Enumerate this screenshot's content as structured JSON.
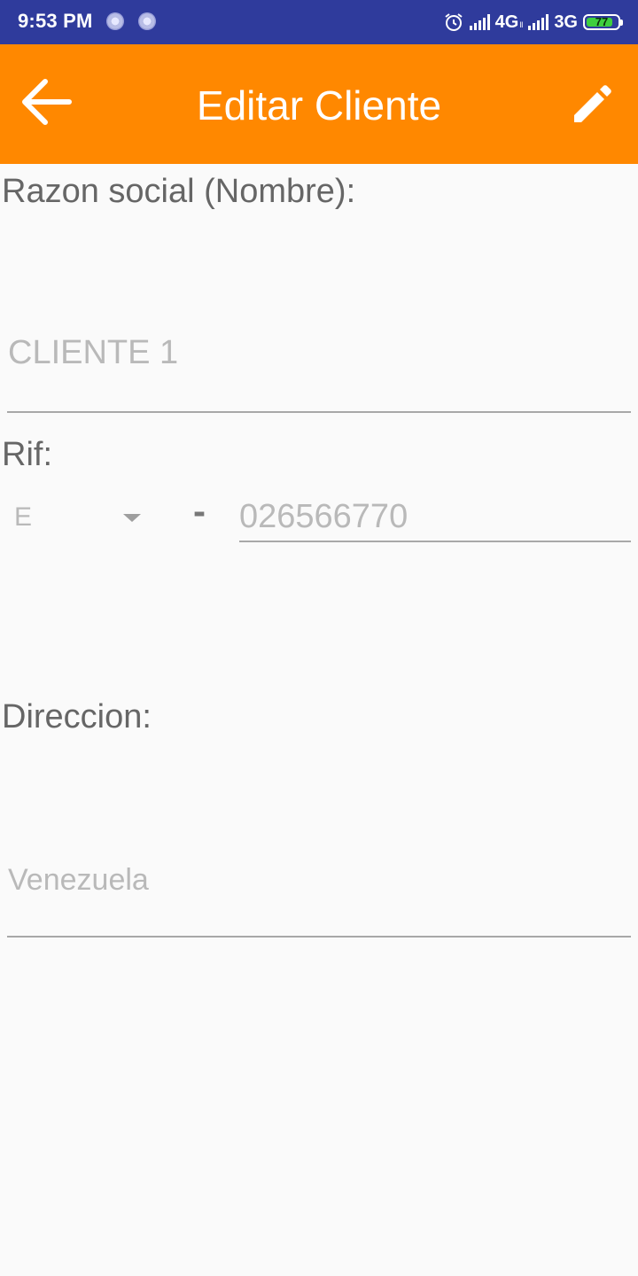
{
  "status_bar": {
    "time": "9:53 PM",
    "network1": "4G",
    "network1_sub": "ll",
    "network2": "3G",
    "battery": "77",
    "icons": [
      "notification-dot-icon",
      "notification-dot-icon",
      "alarm-icon",
      "signal-icon",
      "signal-icon",
      "battery-icon"
    ]
  },
  "app_bar": {
    "title": "Editar Cliente",
    "back_icon": "arrow-back-icon",
    "edit_icon": "pencil-icon",
    "color": "#ff8800"
  },
  "form": {
    "razon_label": "Razon social (Nombre):",
    "razon_value": "CLIENTE 1",
    "rif_label": "Rif:",
    "rif_type": "E",
    "rif_separator": "-",
    "rif_number": "026566770",
    "direccion_label": "Direccion:",
    "direccion_value": "Venezuela"
  }
}
